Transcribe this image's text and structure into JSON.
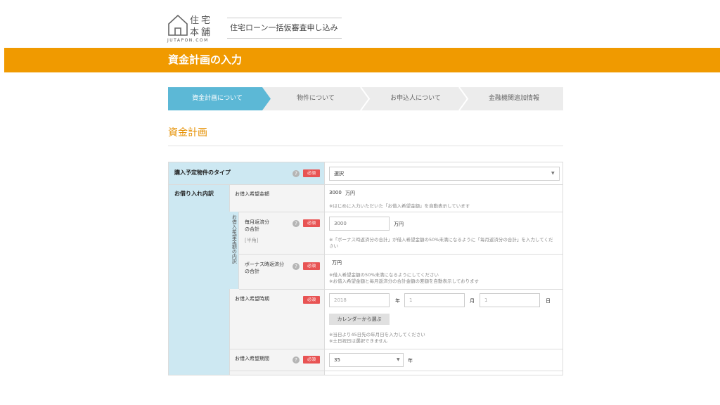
{
  "header": {
    "logo_line1": "住宅",
    "logo_line2": "本舗",
    "logo_line3": "JUTAPON.COM",
    "service_title": "住宅ローン一括仮審査申し込み",
    "page_title": "資金計画の入力"
  },
  "steps": [
    {
      "label": "資金計画について",
      "active": true
    },
    {
      "label": "物件について",
      "active": false
    },
    {
      "label": "お申込人について",
      "active": false
    },
    {
      "label": "金融機関追加情報",
      "active": false
    }
  ],
  "section_title": "資金計画",
  "required_label": "必須",
  "help_symbol": "?",
  "form": {
    "property_type": {
      "label": "購入予定物件のタイプ",
      "value": "選択"
    },
    "loan_details_label": "お借り入れ内訳",
    "desired_amount": {
      "label": "お借入希望金額",
      "value": "3000",
      "unit": "万円",
      "note": "※はじめに入力いただいた「お借入希望金額」を自動表示しています"
    },
    "breakdown_tab": "お借入希望金額の内訳",
    "monthly_total": {
      "label_line1": "毎月返済分",
      "label_line2": "の合計",
      "sub": "[半角]",
      "placeholder": "3000",
      "unit": "万円",
      "note": "※「ボーナス時返済分の合計」が借入希望金額の50%未満になるように「毎月返済分の合計」を入力してください"
    },
    "bonus_total": {
      "label_line1": "ボーナス時返済分",
      "label_line2": "の合計",
      "unit": "万円",
      "note1": "※借入希望金額の50%未満になるようにしてください",
      "note2": "※お借入希望金額と毎月返済分の合計金額の差額を自動表示しております"
    },
    "desired_date": {
      "label": "お借入希望時期",
      "year_value": "2018",
      "year_unit": "年",
      "month_value": "1",
      "month_unit": "月",
      "day_value": "1",
      "day_unit": "日",
      "calendar_button": "カレンダーから選ぶ",
      "note1": "※当日より45日先の年月日を入力してください",
      "note2": "※土日祝日は選択できません"
    },
    "desired_period": {
      "label": "お借入希望期間",
      "value": "35",
      "unit": "年"
    }
  },
  "colors": {
    "brand_orange": "#f09a00",
    "step_active": "#5cb8d6",
    "required_red": "#e85353",
    "label_blue": "#cde8f2"
  }
}
